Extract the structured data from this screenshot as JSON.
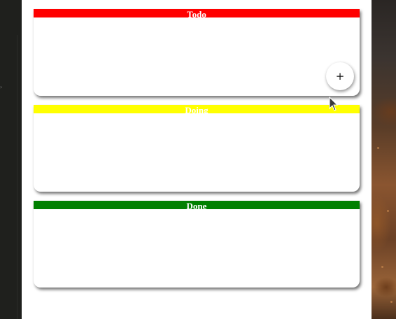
{
  "board": {
    "columns": [
      {
        "title": "Todo",
        "color": "#ff0000"
      },
      {
        "title": "Doing",
        "color": "#ffff00"
      },
      {
        "title": "Done",
        "color": "#008000"
      }
    ],
    "add_button_label": "+"
  },
  "icons": {
    "cursor": "mouse-pointer-icon"
  }
}
